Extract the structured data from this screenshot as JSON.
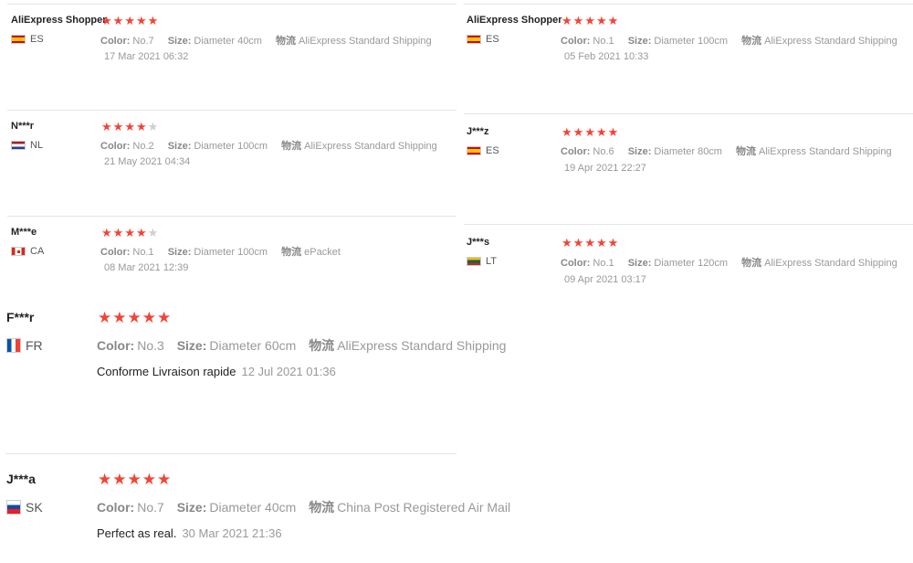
{
  "labels": {
    "color_key": "Color:",
    "size_key": "Size:",
    "shipping_key": "物流"
  },
  "left": [
    {
      "name": "AliExpress Shopper",
      "flag": "es",
      "country": "ES",
      "rating": 5,
      "color": "No.7",
      "size": "Diameter 40cm",
      "shipping": "AliExpress Standard Shipping",
      "date": "17 Mar 2021 06:32"
    },
    {
      "name": "N***r",
      "flag": "nl",
      "country": "NL",
      "rating": 4,
      "color": "No.2",
      "size": "Diameter 100cm",
      "shipping": "AliExpress Standard Shipping",
      "date": "21 May 2021 04:34"
    },
    {
      "name": "M***e",
      "flag": "ca",
      "country": "CA",
      "rating": 4,
      "color": "No.1",
      "size": "Diameter 100cm",
      "shipping": "ePacket",
      "date": "08 Mar 2021 12:39"
    },
    {
      "name": "F***r",
      "flag": "fr",
      "country": "FR",
      "rating": 5,
      "color": "No.3",
      "size": "Diameter 60cm",
      "shipping": "AliExpress Standard Shipping",
      "feedback": "Conforme Livraison rapide",
      "date": "12 Jul 2021 01:36"
    },
    {
      "name": "J***a",
      "flag": "sk",
      "country": "SK",
      "rating": 5,
      "color": "No.7",
      "size": "Diameter 40cm",
      "shipping": "China Post Registered Air Mail",
      "feedback": "Perfect as real.",
      "date": "30 Mar 2021 21:36"
    }
  ],
  "right": [
    {
      "name": "AliExpress Shopper",
      "flag": "es",
      "country": "ES",
      "rating": 5,
      "color": "No.1",
      "size": "Diameter 100cm",
      "shipping": "AliExpress Standard Shipping",
      "date": "05 Feb 2021 10:33"
    },
    {
      "name": "J***z",
      "flag": "es",
      "country": "ES",
      "rating": 5,
      "color": "No.6",
      "size": "Diameter 80cm",
      "shipping": "AliExpress Standard Shipping",
      "date": "19 Apr 2021 22:27"
    },
    {
      "name": "J***s",
      "flag": "lt",
      "country": "LT",
      "rating": 5,
      "color": "No.1",
      "size": "Diameter 120cm",
      "shipping": "AliExpress Standard Shipping",
      "date": "09 Apr 2021 03:17"
    }
  ]
}
